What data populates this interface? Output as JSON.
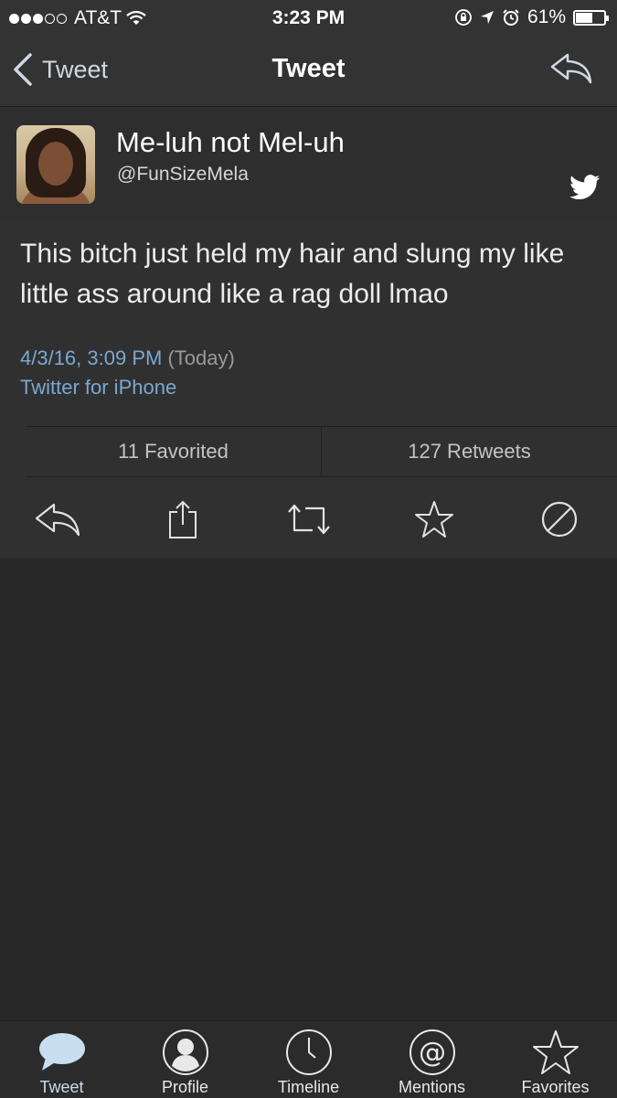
{
  "status_bar": {
    "carrier": "AT&T",
    "time": "3:23 PM",
    "battery": "61%",
    "battery_level": 0.61,
    "signal_bars_filled": 3,
    "signal_bars_total": 5
  },
  "nav": {
    "back_label": "Tweet",
    "title": "Tweet"
  },
  "tweet": {
    "display_name": "Me-luh not Mel-uh",
    "handle": "@FunSizeMela",
    "text": "This bitch just held my hair and slung my like little ass around like a rag doll lmao",
    "date": "4/3/16, 3:09 PM",
    "date_note": "(Today)",
    "source": "Twitter for iPhone"
  },
  "stats": {
    "favorited": "11 Favorited",
    "retweets": "127 Retweets"
  },
  "tab_bar": {
    "tabs": [
      {
        "label": "Tweet",
        "icon": "speech-bubble-icon",
        "active": true
      },
      {
        "label": "Profile",
        "icon": "profile-icon",
        "active": false
      },
      {
        "label": "Timeline",
        "icon": "clock-icon",
        "active": false
      },
      {
        "label": "Mentions",
        "icon": "at-icon",
        "active": false
      },
      {
        "label": "Favorites",
        "icon": "star-icon",
        "active": false
      }
    ]
  },
  "colors": {
    "background": "#282828",
    "bar": "#333333",
    "link": "#7aa8d2",
    "active_tab": "#c9ddf0"
  }
}
